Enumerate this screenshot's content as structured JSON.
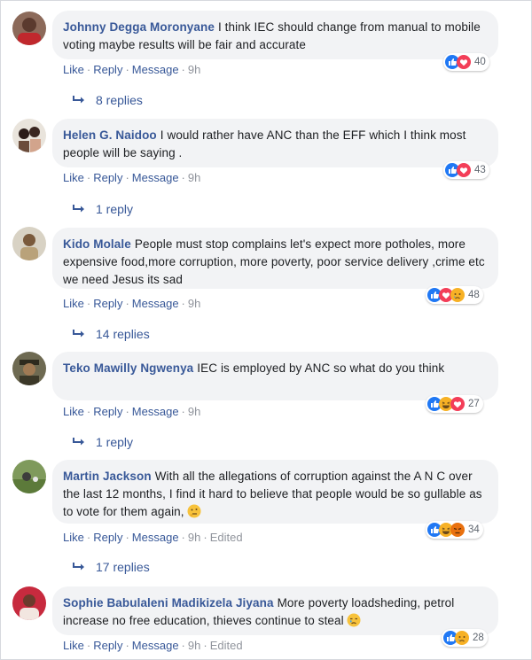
{
  "actions": {
    "like": "Like",
    "reply": "Reply",
    "message": "Message",
    "edited": "Edited"
  },
  "comments": [
    {
      "author": "Johnny Degga Moronyane",
      "text": "I think IEC should change from manual to mobile voting maybe results will be fair and accurate",
      "time": "9h",
      "reactions": [
        "like-icon",
        "love-icon"
      ],
      "reaction_count": "40",
      "replies": "8 replies"
    },
    {
      "author": "Helen G. Naidoo",
      "text": "I would rather have ANC than the EFF which I think most people will be saying .",
      "time": "9h",
      "reactions": [
        "like-icon",
        "love-icon"
      ],
      "reaction_count": "43",
      "replies": "1 reply"
    },
    {
      "author": "Kido Molale",
      "text": "People must stop complains let's expect more potholes, more expensive food,more corruption, more poverty, poor service delivery ,crime etc we need Jesus its sad",
      "time": "9h",
      "reactions": [
        "like-icon",
        "love-icon",
        "sad-icon"
      ],
      "reaction_count": "48",
      "replies": "14 replies"
    },
    {
      "author": "Teko Mawilly Ngwenya",
      "text": "IEC is employed by ANC so what do you think",
      "time": "9h",
      "reactions": [
        "like-icon",
        "haha-icon",
        "love-icon"
      ],
      "reaction_count": "27",
      "replies": "1 reply"
    },
    {
      "author": "Martin Jackson",
      "text": "With all the allegations of corruption against the A N C over the last 12 months, I find it hard to believe that people would be so gullable as to vote for them again,",
      "time": "9h",
      "edited": true,
      "reactions": [
        "like-icon",
        "haha-icon",
        "angry-icon"
      ],
      "reaction_count": "34",
      "replies": "17 replies"
    },
    {
      "author": "Sophie Babulaleni Madikizela Jiyana",
      "text": "More poverty loadsheding, petrol increase no free education, thieves continue to steal",
      "time": "9h",
      "edited": true,
      "reactions": [
        "like-icon",
        "sad-icon"
      ],
      "reaction_count": "28"
    }
  ],
  "colors": {
    "link": "#385898",
    "bubble": "#f2f3f5",
    "like": "#2078f4",
    "love": "#f33e58",
    "meta": "#90949c"
  }
}
